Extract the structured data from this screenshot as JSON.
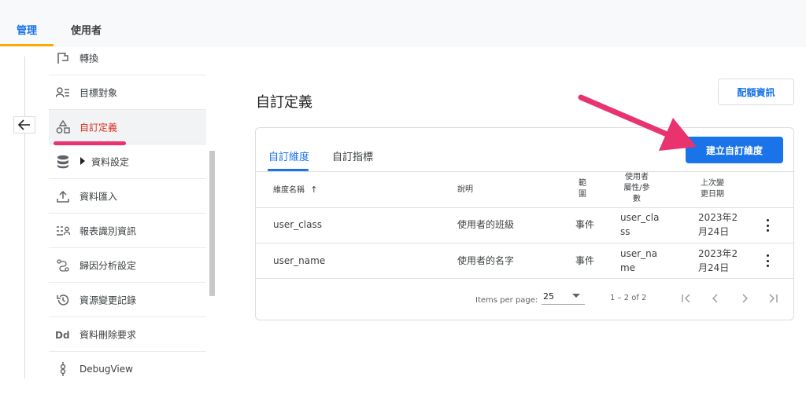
{
  "top_tabs": [
    {
      "label": "管理",
      "active": true
    },
    {
      "label": "使用者",
      "active": false
    }
  ],
  "sidebar": {
    "items": [
      {
        "label": "轉換",
        "icon": "flag-icon"
      },
      {
        "label": "目標對象",
        "icon": "audience-icon"
      },
      {
        "label": "自訂定義",
        "icon": "shapes-icon",
        "active": true
      },
      {
        "label": "資料設定",
        "icon": "database-icon",
        "expandable": true
      },
      {
        "label": "資料匯入",
        "icon": "upload-icon"
      },
      {
        "label": "報表識別資訊",
        "icon": "reporting-identity-icon"
      },
      {
        "label": "歸因分析設定",
        "icon": "attribution-icon"
      },
      {
        "label": "資源變更記錄",
        "icon": "history-icon"
      },
      {
        "label": "資料刪除要求",
        "icon": "data-deletion-icon"
      },
      {
        "label": "DebugView",
        "icon": "debug-icon"
      }
    ]
  },
  "main": {
    "title": "自訂定義",
    "quota_button": "配額資訊",
    "tabs": [
      {
        "label": "自訂維度",
        "active": true
      },
      {
        "label": "自訂指標",
        "active": false
      }
    ],
    "create_button": "建立自訂維度",
    "table": {
      "headers": {
        "name": "維度名稱",
        "description": "說明",
        "scope_line1": "範",
        "scope_line2": "圍",
        "user_prop_line1": "使用者",
        "user_prop_line2": "屬性/參",
        "user_prop_line3": "數",
        "last_changed_line1": "上次變",
        "last_changed_line2": "更日期"
      },
      "sort_indicator": "↑",
      "rows": [
        {
          "name": "user_class",
          "description": "使用者的班級",
          "scope": "事件",
          "param_line1": "user_cla",
          "param_line2": "ss",
          "date_line1": "2023年2",
          "date_line2": "月24日"
        },
        {
          "name": "user_name",
          "description": "使用者的名字",
          "scope": "事件",
          "param_line1": "user_na",
          "param_line2": "me",
          "date_line1": "2023年2",
          "date_line2": "月24日"
        }
      ]
    },
    "pagination": {
      "items_per_page_label": "Items per page:",
      "page_size": "25",
      "range_text": "1 – 2 of 2"
    }
  },
  "colors": {
    "accent": "#1a73e8",
    "active_nav_text": "#d93025",
    "annotation": "#e8336e",
    "tab_underline_top": "#f9ab00"
  }
}
